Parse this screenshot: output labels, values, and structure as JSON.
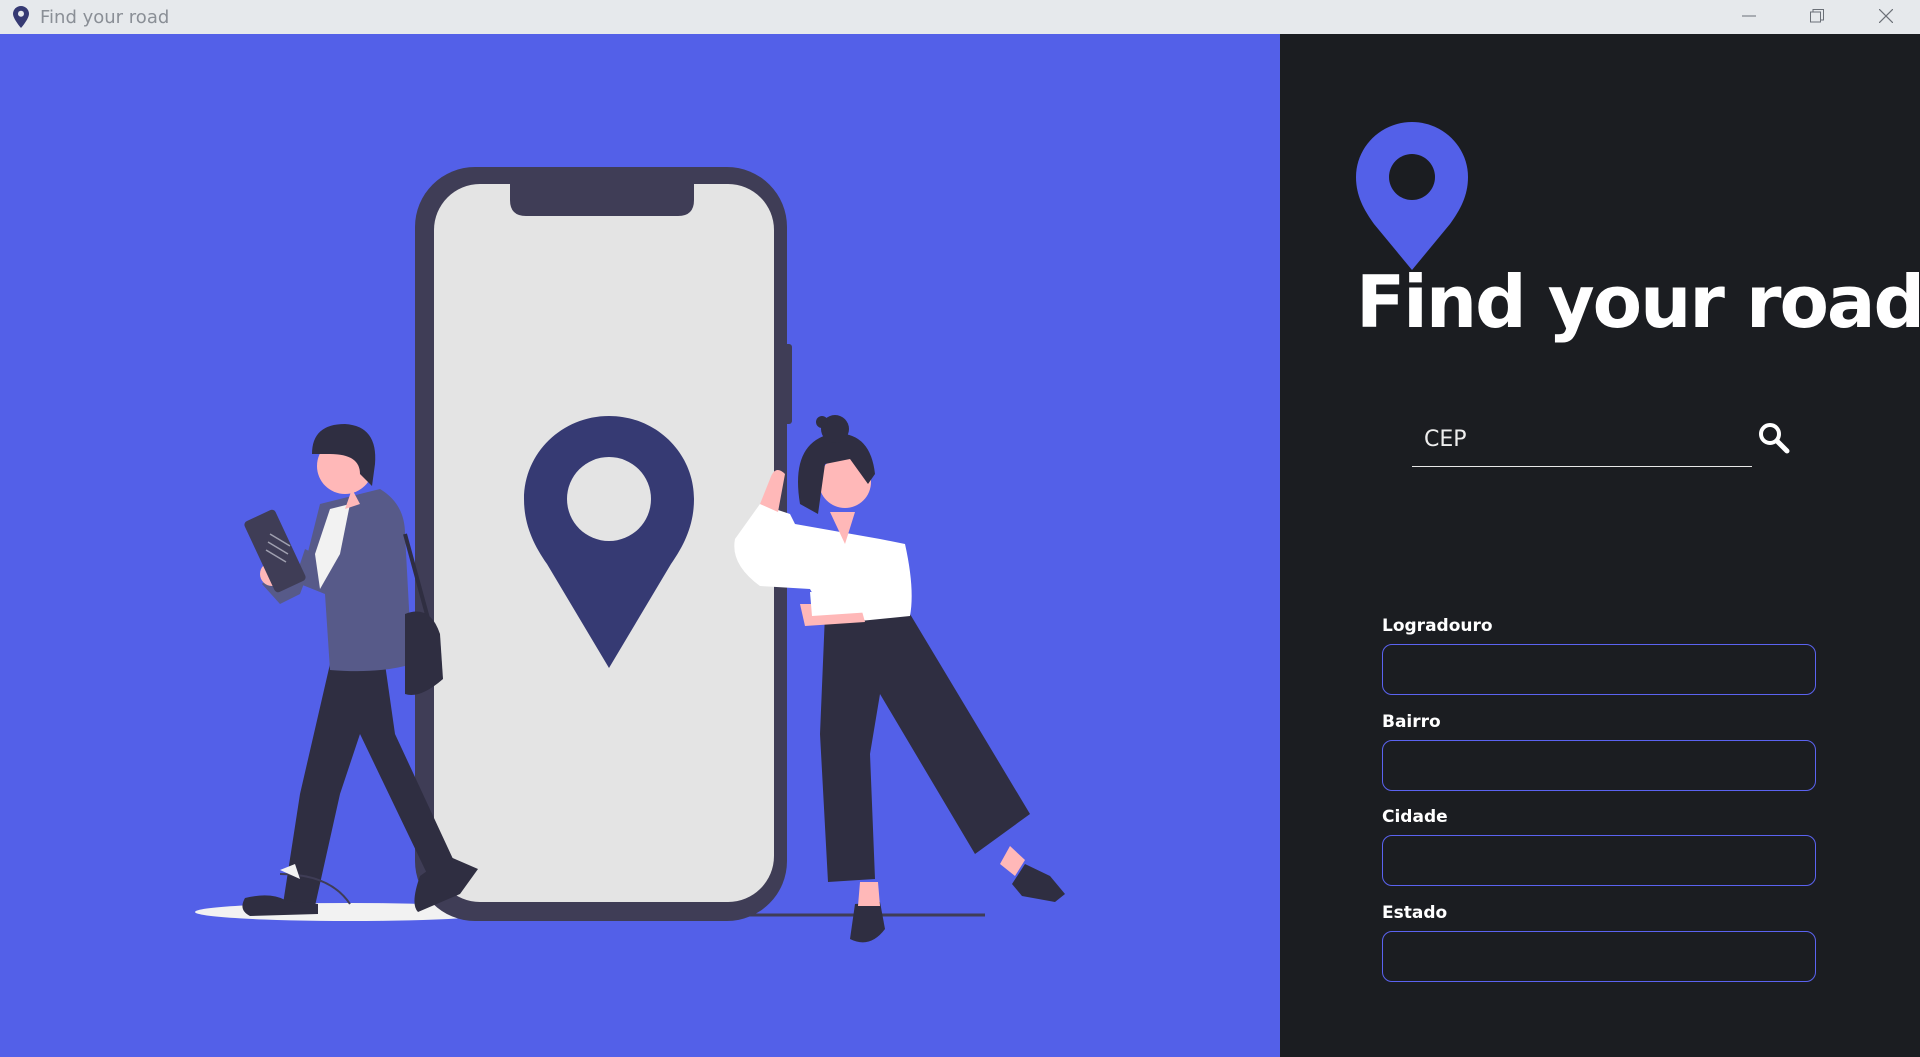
{
  "window": {
    "title": "Find your road",
    "icons": {
      "app": "map-pin-icon",
      "minimize": "minimize-icon",
      "maximize": "restore-icon",
      "close": "close-icon"
    }
  },
  "colors": {
    "accent": "#5360e8",
    "panel_bg": "#1b1d21",
    "titlebar_bg": "#e6e9ec",
    "field_border": "#5b63f0",
    "phone_frame": "#3f3d56",
    "phone_screen": "#e4e4e4",
    "pin_dark": "#363a73"
  },
  "brand": {
    "heading": "Find your road",
    "logo_icon": "map-pin-icon"
  },
  "search": {
    "placeholder": "CEP",
    "value": "",
    "icon": "search-icon"
  },
  "fields": [
    {
      "label": "Logradouro",
      "value": ""
    },
    {
      "label": "Bairro",
      "value": ""
    },
    {
      "label": "Cidade",
      "value": ""
    },
    {
      "label": "Estado",
      "value": ""
    }
  ]
}
